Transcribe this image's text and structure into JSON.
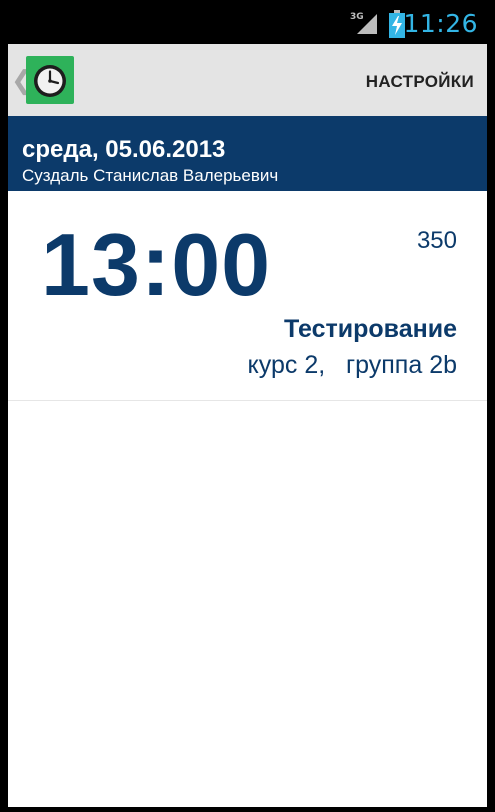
{
  "status_bar": {
    "network_label": "3G",
    "time": "11:26",
    "accent_color": "#33b5e5",
    "icons": [
      "signal-icon",
      "battery-charging-icon"
    ]
  },
  "action_bar": {
    "up_icon": "chevron-left-icon",
    "app_icon": "clock-icon",
    "settings_label": "НАСТРОЙКИ"
  },
  "header": {
    "date": "среда, 05.06.2013",
    "person": "Суздаль Станислав Валерьевич",
    "background_color": "#0c3a6a"
  },
  "lessons": [
    {
      "time": "13:00",
      "room": "350",
      "subject": "Тестирование",
      "group": "курс 2,   группа 2b"
    }
  ]
}
